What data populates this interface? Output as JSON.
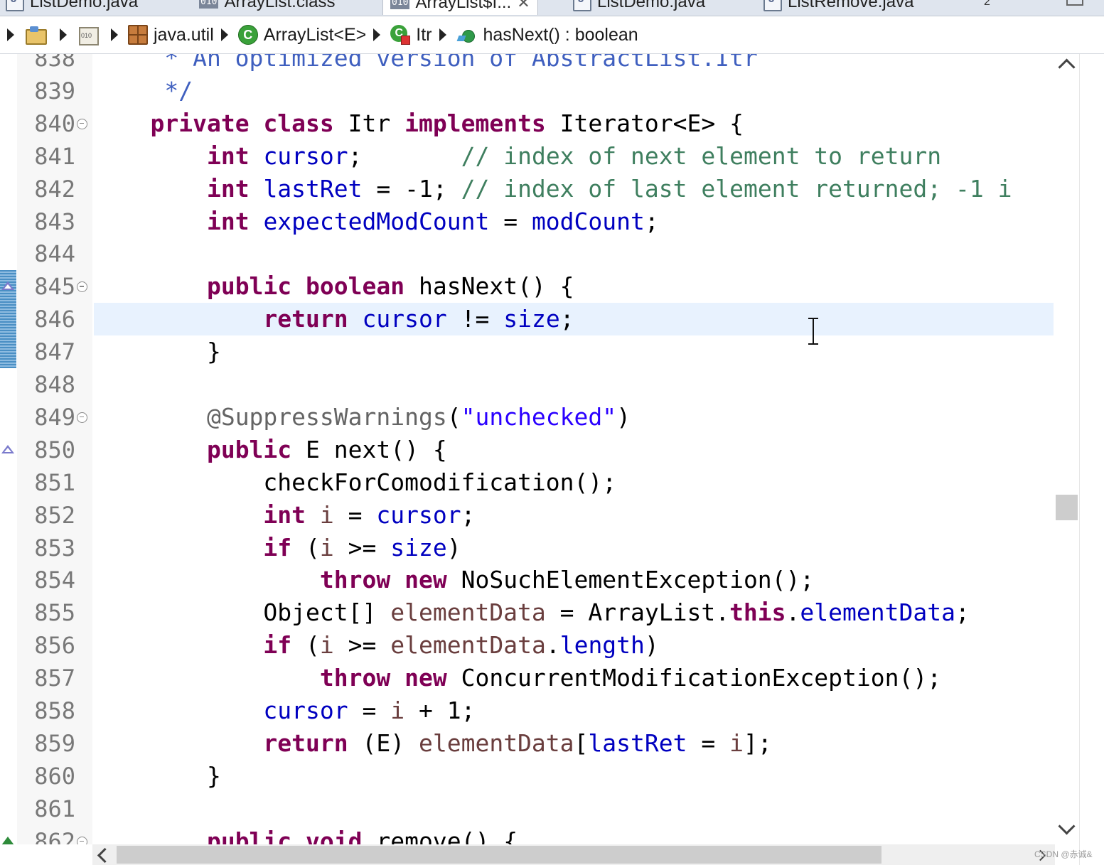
{
  "tabs": [
    {
      "label": "ListDemo.java",
      "icon": "java-file-icon"
    },
    {
      "label": "ArrayList.class",
      "icon": "class-file-icon"
    },
    {
      "label": "ArrayList$I...",
      "icon": "class-file-icon",
      "active": true
    },
    {
      "label": "ListDemo.java",
      "icon": "java-file-icon"
    },
    {
      "label": "ListRemove.java",
      "icon": "java-file-icon"
    }
  ],
  "tab_overflow_count": "2",
  "breadcrumb": {
    "package": "java.util",
    "class": "ArrayList<E>",
    "inner_class": "Itr",
    "method": "hasNext() : boolean"
  },
  "editor": {
    "current_line": 846,
    "lines": [
      {
        "num": "838",
        "tokens": [
          [
            "jdoc",
            "     * An optimized version of AbstractList.Itr"
          ]
        ]
      },
      {
        "num": "839",
        "tokens": [
          [
            "jdoc",
            "     */"
          ]
        ]
      },
      {
        "num": "840",
        "fold": true,
        "tokens": [
          [
            "",
            "    "
          ],
          [
            "kw",
            "private"
          ],
          [
            "",
            " "
          ],
          [
            "kw",
            "class"
          ],
          [
            "",
            " Itr "
          ],
          [
            "kw",
            "implements"
          ],
          [
            "",
            " Iterator<E> {"
          ]
        ]
      },
      {
        "num": "841",
        "tokens": [
          [
            "",
            "        "
          ],
          [
            "kw",
            "int"
          ],
          [
            "",
            " "
          ],
          [
            "fld",
            "cursor"
          ],
          [
            "",
            ";       "
          ],
          [
            "cmt",
            "// index of next element to return"
          ]
        ]
      },
      {
        "num": "842",
        "tokens": [
          [
            "",
            "        "
          ],
          [
            "kw",
            "int"
          ],
          [
            "",
            " "
          ],
          [
            "fld",
            "lastRet"
          ],
          [
            "",
            " = -1; "
          ],
          [
            "cmt",
            "// index of last element returned; -1 i"
          ]
        ]
      },
      {
        "num": "843",
        "tokens": [
          [
            "",
            "        "
          ],
          [
            "kw",
            "int"
          ],
          [
            "",
            " "
          ],
          [
            "fld",
            "expectedModCount"
          ],
          [
            "",
            " = "
          ],
          [
            "fld",
            "modCount"
          ],
          [
            "",
            ";"
          ]
        ]
      },
      {
        "num": "844",
        "tokens": []
      },
      {
        "num": "845",
        "fold": true,
        "marker": "override",
        "tokens": [
          [
            "",
            "        "
          ],
          [
            "kw",
            "public"
          ],
          [
            "",
            " "
          ],
          [
            "kw",
            "boolean"
          ],
          [
            "",
            " hasNext() {"
          ]
        ]
      },
      {
        "num": "846",
        "highlight": true,
        "tokens": [
          [
            "",
            "            "
          ],
          [
            "kw",
            "return"
          ],
          [
            "",
            " "
          ],
          [
            "fld",
            "cursor"
          ],
          [
            "",
            " != "
          ],
          [
            "fld",
            "size"
          ],
          [
            "",
            ";"
          ]
        ]
      },
      {
        "num": "847",
        "tokens": [
          [
            "",
            "        }"
          ]
        ]
      },
      {
        "num": "848",
        "tokens": []
      },
      {
        "num": "849",
        "fold": true,
        "tokens": [
          [
            "",
            "        "
          ],
          [
            "ann",
            "@SuppressWarnings"
          ],
          [
            "",
            "("
          ],
          [
            "str",
            "\"unchecked\""
          ],
          [
            "",
            ")"
          ]
        ]
      },
      {
        "num": "850",
        "marker": "override",
        "tokens": [
          [
            "",
            "        "
          ],
          [
            "kw",
            "public"
          ],
          [
            "",
            " E next() {"
          ]
        ]
      },
      {
        "num": "851",
        "tokens": [
          [
            "",
            "            checkForComodification();"
          ]
        ]
      },
      {
        "num": "852",
        "tokens": [
          [
            "",
            "            "
          ],
          [
            "kw",
            "int"
          ],
          [
            "",
            " "
          ],
          [
            "loc",
            "i"
          ],
          [
            "",
            " = "
          ],
          [
            "fld",
            "cursor"
          ],
          [
            "",
            ";"
          ]
        ]
      },
      {
        "num": "853",
        "tokens": [
          [
            "",
            "            "
          ],
          [
            "kw",
            "if"
          ],
          [
            "",
            " ("
          ],
          [
            "loc",
            "i"
          ],
          [
            "",
            " >= "
          ],
          [
            "fld",
            "size"
          ],
          [
            "",
            ")"
          ]
        ]
      },
      {
        "num": "854",
        "tokens": [
          [
            "",
            "                "
          ],
          [
            "kw",
            "throw"
          ],
          [
            "",
            " "
          ],
          [
            "kw",
            "new"
          ],
          [
            "",
            " NoSuchElementException();"
          ]
        ]
      },
      {
        "num": "855",
        "tokens": [
          [
            "",
            "            Object[] "
          ],
          [
            "loc",
            "elementData"
          ],
          [
            "",
            " = ArrayList."
          ],
          [
            "kw",
            "this"
          ],
          [
            "",
            "."
          ],
          [
            "fld",
            "elementData"
          ],
          [
            "",
            ";"
          ]
        ]
      },
      {
        "num": "856",
        "tokens": [
          [
            "",
            "            "
          ],
          [
            "kw",
            "if"
          ],
          [
            "",
            " ("
          ],
          [
            "loc",
            "i"
          ],
          [
            "",
            " >= "
          ],
          [
            "loc",
            "elementData"
          ],
          [
            "",
            "."
          ],
          [
            "fld",
            "length"
          ],
          [
            "",
            ")"
          ]
        ]
      },
      {
        "num": "857",
        "tokens": [
          [
            "",
            "                "
          ],
          [
            "kw",
            "throw"
          ],
          [
            "",
            " "
          ],
          [
            "kw",
            "new"
          ],
          [
            "",
            " ConcurrentModificationException();"
          ]
        ]
      },
      {
        "num": "858",
        "tokens": [
          [
            "",
            "            "
          ],
          [
            "fld",
            "cursor"
          ],
          [
            "",
            " = "
          ],
          [
            "loc",
            "i"
          ],
          [
            "",
            " + 1;"
          ]
        ]
      },
      {
        "num": "859",
        "tokens": [
          [
            "",
            "            "
          ],
          [
            "kw",
            "return"
          ],
          [
            "",
            " (E) "
          ],
          [
            "loc",
            "elementData"
          ],
          [
            "",
            "["
          ],
          [
            "fld",
            "lastRet"
          ],
          [
            "",
            " = "
          ],
          [
            "loc",
            "i"
          ],
          [
            "",
            "];"
          ]
        ]
      },
      {
        "num": "860",
        "tokens": [
          [
            "",
            "        }"
          ]
        ]
      },
      {
        "num": "861",
        "tokens": []
      },
      {
        "num": "862",
        "fold": true,
        "marker": "implement",
        "tokens": [
          [
            "",
            "        "
          ],
          [
            "kw",
            "public"
          ],
          [
            "",
            " "
          ],
          [
            "kw",
            "void"
          ],
          [
            "",
            " remove() {"
          ]
        ]
      }
    ]
  },
  "watermark": "CSDN @赤诚&",
  "colors": {
    "keyword": "#7f0055",
    "field": "#0000c0",
    "comment": "#3f7f5f",
    "javadoc": "#3f5fbf",
    "string": "#2a00ff",
    "annotation": "#646464",
    "current_line": "#e8f2fe"
  }
}
